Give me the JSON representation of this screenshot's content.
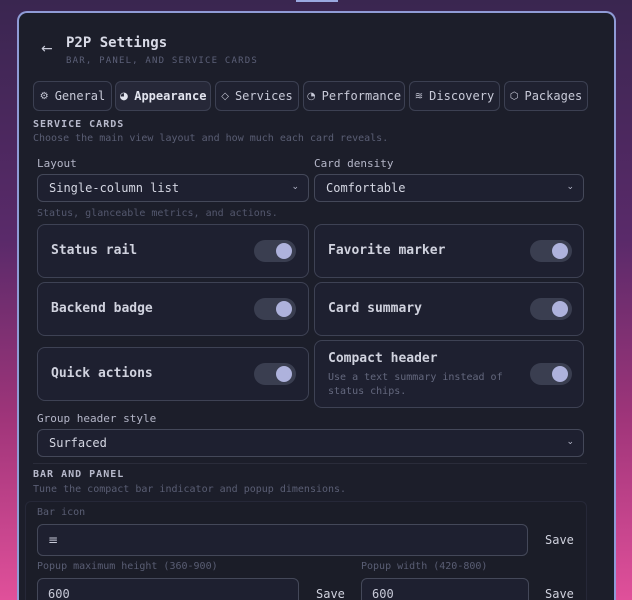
{
  "header": {
    "back_icon": "arrow-left-icon",
    "title": "P2P Settings",
    "subtitle": "BAR, PANEL, AND SERVICE CARDS"
  },
  "tabs": [
    {
      "label": "General",
      "icon": "gear-icon",
      "active": false
    },
    {
      "label": "Appearance",
      "icon": "palette-icon",
      "active": true
    },
    {
      "label": "Services",
      "icon": "tag-icon",
      "active": false
    },
    {
      "label": "Performance",
      "icon": "gauge-icon",
      "active": false
    },
    {
      "label": "Discovery",
      "icon": "signal-icon",
      "active": false
    },
    {
      "label": "Packages",
      "icon": "box-icon",
      "active": false
    }
  ],
  "service_cards": {
    "title": "SERVICE CARDS",
    "description": "Choose the main view layout and how much each card reveals.",
    "layout_label": "Layout",
    "layout_value": "Single-column list",
    "density_label": "Card density",
    "density_value": "Comfortable",
    "hint": "Status, glanceable metrics, and actions.",
    "toggles": {
      "status_rail": {
        "label": "Status rail",
        "on": true
      },
      "favorite_marker": {
        "label": "Favorite marker",
        "on": true
      },
      "backend_badge": {
        "label": "Backend badge",
        "on": true
      },
      "card_summary": {
        "label": "Card summary",
        "on": true
      },
      "quick_actions": {
        "label": "Quick actions",
        "on": true
      },
      "compact_header": {
        "label": "Compact header",
        "description": "Use a text summary instead of status chips.",
        "on": true
      }
    },
    "group_header_label": "Group header style",
    "group_header_value": "Surfaced"
  },
  "bar_and_panel": {
    "title": "BAR AND PANEL",
    "description": "Tune the compact bar indicator and popup dimensions.",
    "bar_icon_label": "Bar icon",
    "bar_icon_glyph": "≡",
    "save_label": "Save",
    "popup_height_label": "Popup maximum height (360-900)",
    "popup_height_value": "600",
    "popup_width_label": "Popup width (420-800)",
    "popup_width_value": "600"
  },
  "colors": {
    "panel_bg": "#1c1e2a",
    "panel_border": "#8f9bd6",
    "toggle_knob": "#aeb2dc"
  }
}
